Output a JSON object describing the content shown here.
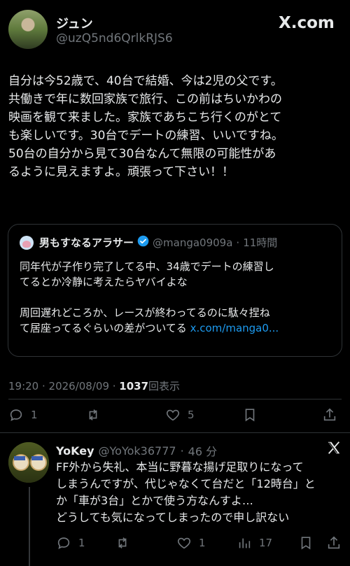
{
  "post": {
    "author_name": "ジュン",
    "author_handle": "@uzQ5nd6QrlkRJS6",
    "brand": "X.com",
    "body_lines": [
      "自分は今52歳で、40台で結婚、今は2児の父です。",
      "共働きで年に数回家族で旅行、この前はちいかわの",
      "映画を観て来ました。家族であちこち行くのがとて",
      "も楽しいです。30台でデートの練習、いいですね。",
      "50台の自分から見て30台なんて無限の可能性があ",
      "るように見えますよ。頑張って下さい！！"
    ],
    "quote": {
      "author_name": "男もすなるアラサー",
      "author_handle": "@manga0909a",
      "time": "11時間",
      "lines": [
        "同年代が子作り完了してる中、34歳でデートの練習し",
        "てるとか冷静に考えたらヤバイよな",
        "",
        "周回遅れどころか、レースが終わってるのに駄々捏ね"
      ],
      "last_line": "て居座ってるぐらいの差がついてる",
      "link": "x.com/manga0..."
    },
    "timestamp": "19:20 · 2026/08/09 · ",
    "views_count": "1037",
    "views_label": "回表示",
    "actions": {
      "replies": "1",
      "reposts": "",
      "likes": "5"
    }
  },
  "reply": {
    "author_name": "YoKey",
    "author_handle": "@YoYok36777",
    "time": "46 分",
    "lines": [
      "FF外から失礼、本当に野暮な揚げ足取りになって",
      "しまうんですが、代じゃなくて台だと「12時台」と",
      "か「車が3台」とかで使う方なんすよ…",
      "どうしても気になってしまったので申し訳ない"
    ],
    "actions": {
      "replies": "1",
      "reposts": "",
      "likes": "1",
      "views": "17"
    }
  },
  "colors": {
    "background": "#000000",
    "text": "#e7e9ea",
    "muted": "#71767b",
    "link": "#1d9bf0",
    "border": "#2f3336"
  }
}
